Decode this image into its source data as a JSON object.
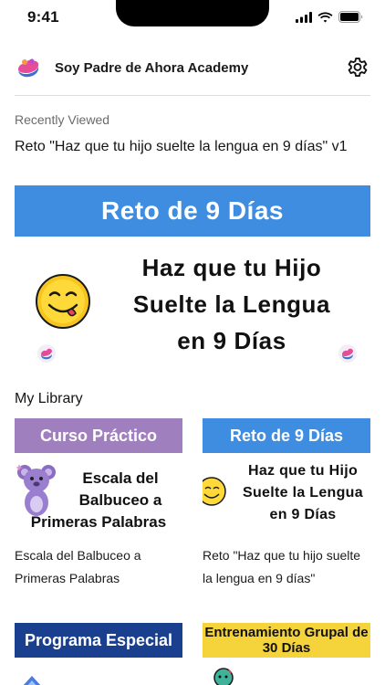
{
  "status": {
    "time": "9:41"
  },
  "header": {
    "title": "Soy Padre de Ahora Academy"
  },
  "recent": {
    "label": "Recently Viewed",
    "title": "Reto \"Haz que tu hijo suelte la lengua en 9 días\" v1",
    "banner": {
      "band_text": "Reto de 9 Días",
      "headline_lines": [
        "Haz que tu Hijo",
        "Suelte la Lengua",
        "en 9 Días"
      ],
      "band_color": "#3f8de0"
    }
  },
  "library": {
    "label": "My Library",
    "cards": [
      {
        "band_text": "Curso Práctico",
        "band_color": "#a07fbf",
        "thumb_lines": [
          "Escala del",
          "Balbuceo a",
          "Primeras Palabras"
        ],
        "caption": "Escala del Balbuceo a Primeras Palabras"
      },
      {
        "band_text": "Reto de 9 Días",
        "band_color": "#3f8de0",
        "thumb_lines": [
          "Haz que tu Hijo",
          "Suelte la Lengua",
          "en 9 Días"
        ],
        "caption": "Reto \"Haz que tu hijo suelte la lengua en 9 días\""
      },
      {
        "band_text": "Programa Especial",
        "band_color": "#1b3f8f"
      },
      {
        "band_text": "Entrenamiento Grupal de 30 Días",
        "band_color": "#f5d33b"
      }
    ]
  }
}
